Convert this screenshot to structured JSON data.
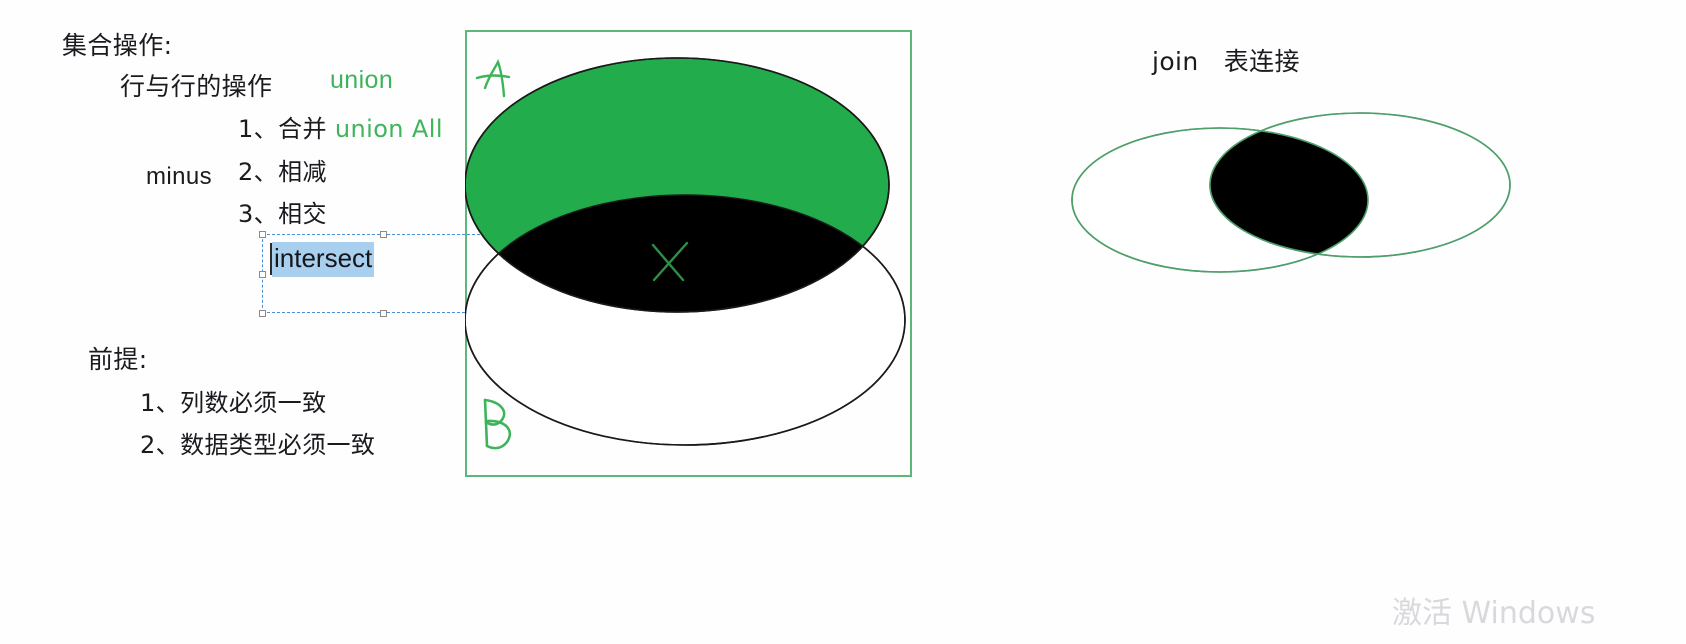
{
  "slide": {
    "background_color": "#fefeff",
    "left_panel": {
      "title": "集合操作:",
      "row_operation_label": "行与行的操作",
      "union_keyword": "union",
      "items": [
        {
          "number": "1、",
          "text": "合并 ",
          "keyword": "union All"
        },
        {
          "number": "2、",
          "text": "相减",
          "keyword": ""
        },
        {
          "number": "3、",
          "text": "相交",
          "keyword": ""
        }
      ],
      "minus_keyword": "minus",
      "prerequisite_title": "前提:",
      "prerequisites": [
        "1、列数必须一致",
        "2、数据类型必须一致"
      ]
    },
    "selected_textbox": {
      "value": "intersect",
      "selected": true,
      "selection_highlight_color": "#a8cfee",
      "border_style": "dashed",
      "border_color": "#4a90d9",
      "handles": 8
    },
    "set_diagram": {
      "frame_border_color": "#5cb878",
      "label_a": "A",
      "label_b": "B",
      "mark": "X",
      "ellipse_a_fill": "#22ac4b",
      "ellipse_b_fill": "#ffffff",
      "intersection_fill": "#000000",
      "outline_color": "#1a1a1a",
      "annotation_color": "#3eb45a"
    },
    "join_diagram": {
      "title_en": "join",
      "title_cn": "表连接",
      "outline_color": "#4f9f6b",
      "intersection_fill": "#000000"
    },
    "watermark": "激活 Windows"
  }
}
